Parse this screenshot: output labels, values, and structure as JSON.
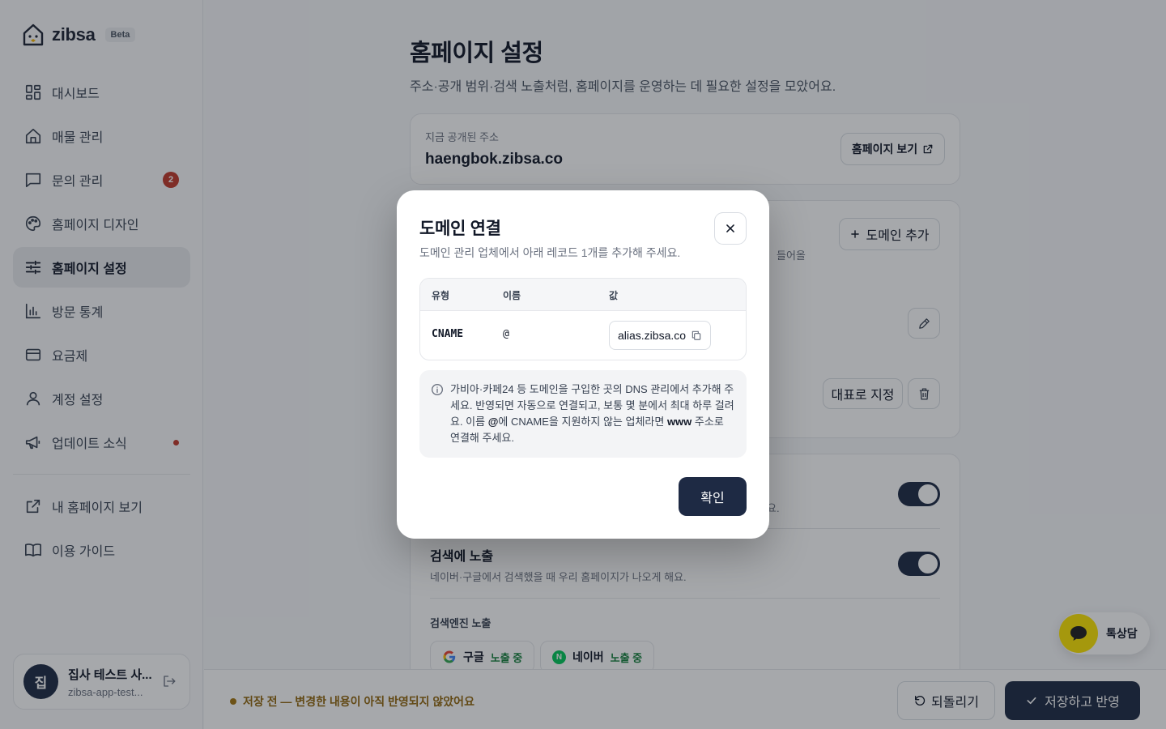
{
  "sidebar": {
    "brand": "zibsa",
    "beta": "Beta",
    "items": [
      {
        "label": "대시보드"
      },
      {
        "label": "매물 관리"
      },
      {
        "label": "문의 관리",
        "badge": "2"
      },
      {
        "label": "홈페이지 디자인"
      },
      {
        "label": "홈페이지 설정"
      },
      {
        "label": "방문 통계"
      },
      {
        "label": "요금제"
      },
      {
        "label": "계정 설정"
      },
      {
        "label": "업데이트 소식"
      }
    ],
    "links": [
      {
        "label": "내 홈페이지 보기"
      },
      {
        "label": "이용 가이드"
      }
    ],
    "profile": {
      "initial": "집",
      "name": "집사 테스트 사...",
      "email": "zibsa-app-test..."
    }
  },
  "page": {
    "title": "홈페이지 설정",
    "subtitle": "주소·공개 범위·검색 노출처럼, 홈페이지를 운영하는 데 필요한 설정을 모았어요."
  },
  "address_card": {
    "label": "지금 공개된 주소",
    "value": "haengbok.zibsa.co",
    "view_button": "홈페이지 보기"
  },
  "domain_card": {
    "add_button": "도메인 추가",
    "partial_desc": "들어올",
    "set_primary": "대표로 지정"
  },
  "visibility_card": {
    "partial_desc": "요.",
    "search_title": "검색에 노출",
    "search_desc": "네이버·구글에서 검색했을 때 우리 홈페이지가 나오게 해요.",
    "engine_label": "검색엔진 노출",
    "engines": [
      {
        "name": "구글",
        "status": "노출 중"
      },
      {
        "name": "네이버",
        "status": "노출 중"
      }
    ]
  },
  "bottom_bar": {
    "unsaved": "저장 전 — 변경한 내용이 아직 반영되지 않았어요",
    "revert": "되돌리기",
    "save": "저장하고 반영"
  },
  "chat": {
    "label": "톡상담"
  },
  "modal": {
    "title": "도메인 연결",
    "subtitle": "도메인 관리 업체에서 아래 레코드 1개를 추가해 주세요.",
    "columns": [
      "유형",
      "이름",
      "값"
    ],
    "record": {
      "type": "CNAME",
      "name": "@",
      "value": "alias.zibsa.co"
    },
    "info_1": "가비아·카페24 등 도메인을 구입한 곳의 DNS 관리에서 추가해 주세요. 반영되면 자동으로 연결되고, 보통 몇 분에서 최대 하루 걸려요. 이름 ",
    "info_at": "@",
    "info_2": "에 CNAME을 지원하지 않는 업체라면 ",
    "info_www": "www",
    "info_3": " 주소로 연결해 주세요.",
    "confirm": "확인"
  },
  "colors": {
    "primary": "#1e2a44",
    "badge": "#c0392b",
    "warning_text": "#92660d",
    "status_green": "#15803d",
    "chat_yellow": "#fee500"
  }
}
